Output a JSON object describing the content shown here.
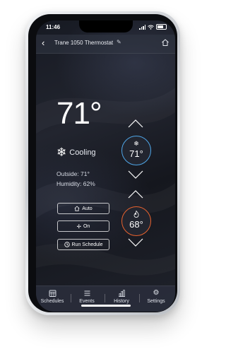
{
  "status": {
    "time": "11:46"
  },
  "header": {
    "title": "Trane 1050 Thermostat"
  },
  "display": {
    "temperature": "71°",
    "mode": "Cooling",
    "outside": "Outside: 71°",
    "humidity": "Humidity: 62%"
  },
  "controls": {
    "mode_button": "Auto",
    "fan_button": "On",
    "schedule_button": "Run Schedule"
  },
  "setpoints": {
    "cool": "71°",
    "heat": "68°"
  },
  "tabs": [
    {
      "label": "Schedules",
      "icon": "calendar-icon"
    },
    {
      "label": "Events",
      "icon": "list-icon"
    },
    {
      "label": "History",
      "icon": "bar-chart-icon"
    },
    {
      "label": "Settings",
      "icon": "gear-icon"
    }
  ],
  "colors": {
    "cool_ring": "#4fa6e8",
    "heat_ring": "#e8622e"
  }
}
